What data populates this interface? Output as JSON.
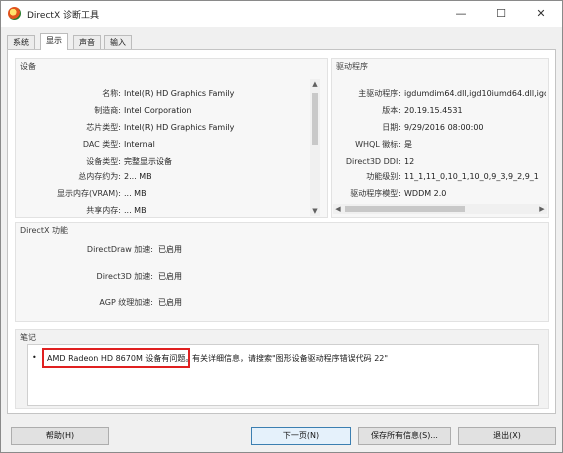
{
  "window": {
    "title": "DirectX 诊断工具",
    "minimize": "—",
    "maximize": "☐",
    "close": "✕"
  },
  "tabs": [
    {
      "label": "系统",
      "active": false
    },
    {
      "label": "显示",
      "active": true
    },
    {
      "label": "声音",
      "active": false
    },
    {
      "label": "输入",
      "active": false
    }
  ],
  "device": {
    "title": "设备",
    "rows": [
      {
        "label": "名称:",
        "value": "Intel(R) HD Graphics Family"
      },
      {
        "label": "制造商:",
        "value": "Intel Corporation"
      },
      {
        "label": "芯片类型:",
        "value": "Intel(R) HD Graphics Family"
      },
      {
        "label": "DAC 类型:",
        "value": "Internal"
      },
      {
        "label": "设备类型:",
        "value": "完整显示设备"
      },
      {
        "label": "总内存约为:",
        "value": "2... MB"
      },
      {
        "label": "显示内存(VRAM):",
        "value": "... MB"
      },
      {
        "label": "共享内存:",
        "value": "... MB"
      }
    ]
  },
  "driver": {
    "title": "驱动程序",
    "rows": [
      {
        "label": "主驱动程序:",
        "value": "igdumdim64.dll,igd10iumd64.dll,igd1"
      },
      {
        "label": "版本:",
        "value": "20.19.15.4531"
      },
      {
        "label": "日期:",
        "value": "9/29/2016 08:00:00"
      },
      {
        "label": "WHQL 徽标:",
        "value": "是"
      },
      {
        "label": "Direct3D DDI:",
        "value": "12"
      },
      {
        "label": "功能级别:",
        "value": "11_1,11_0,10_1,10_0,9_3,9_2,9_1"
      },
      {
        "label": "驱动程序模型:",
        "value": "WDDM 2.0"
      }
    ]
  },
  "directx": {
    "title": "DirectX 功能",
    "rows": [
      {
        "label": "DirectDraw 加速:",
        "value": "已启用"
      },
      {
        "label": "Direct3D 加速:",
        "value": "已启用"
      },
      {
        "label": "AGP 纹理加速:",
        "value": "已启用"
      }
    ]
  },
  "notes": {
    "title": "笔记",
    "bullet": "•",
    "highlighted": "AMD Radeon HD 8670M 设备有问题。",
    "rest": "有关详细信息，请搜索\"图形设备驱动程序错误代码 22\""
  },
  "buttons": {
    "help": "帮助(H)",
    "next": "下一页(N)",
    "save": "保存所有信息(S)...",
    "exit": "退出(X)"
  },
  "colors": {
    "highlight_border": "#e02020",
    "accent": "#3c7fb1"
  }
}
